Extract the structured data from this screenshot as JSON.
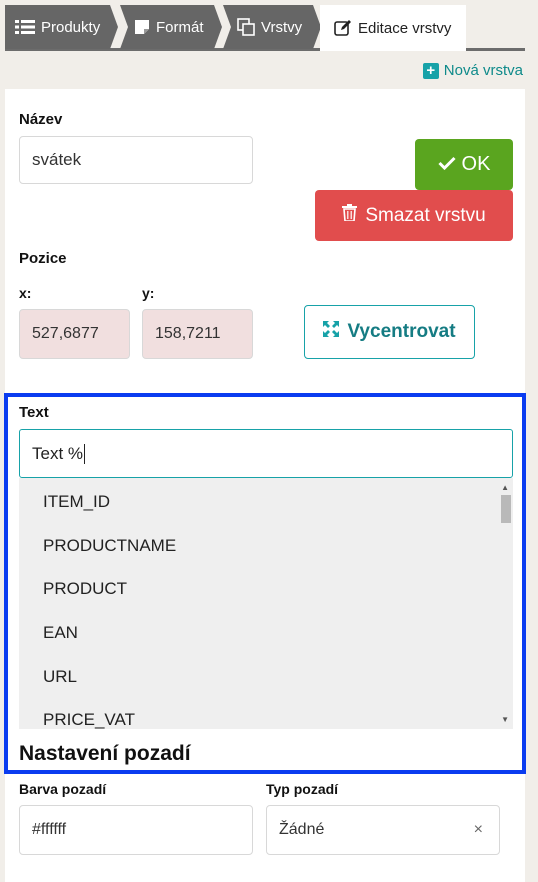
{
  "tabs": [
    {
      "label": "Produkty",
      "icon": "list-icon"
    },
    {
      "label": "Formát",
      "icon": "note-icon"
    },
    {
      "label": "Vrstvy",
      "icon": "layers-icon"
    },
    {
      "label": "Editace vrstvy",
      "icon": "edit-icon"
    }
  ],
  "new_layer_label": "Nová vrstva",
  "name": {
    "label": "Název",
    "value": "svátek"
  },
  "ok_label": "OK",
  "delete_label": "Smazat vrstvu",
  "position": {
    "label": "Pozice",
    "x_label": "x:",
    "y_label": "y:",
    "x_value": "527,6877",
    "y_value": "158,7211"
  },
  "center_label": "Vycentrovat",
  "text": {
    "label": "Text",
    "value": "Text %",
    "suggestions": [
      "ITEM_ID",
      "PRODUCTNAME",
      "PRODUCT",
      "EAN",
      "URL",
      "PRICE_VAT"
    ]
  },
  "background_section_title": "Nastavení pozadí",
  "background": {
    "color_label": "Barva pozadí",
    "color_value": "#ffffff",
    "type_label": "Typ pozadí",
    "type_value": "Žádné",
    "clear_symbol": "×"
  },
  "colors": {
    "accent": "#17a2a8",
    "ok": "#5aa51f",
    "danger": "#e14d4d",
    "highlight": "#0a3cf0"
  }
}
